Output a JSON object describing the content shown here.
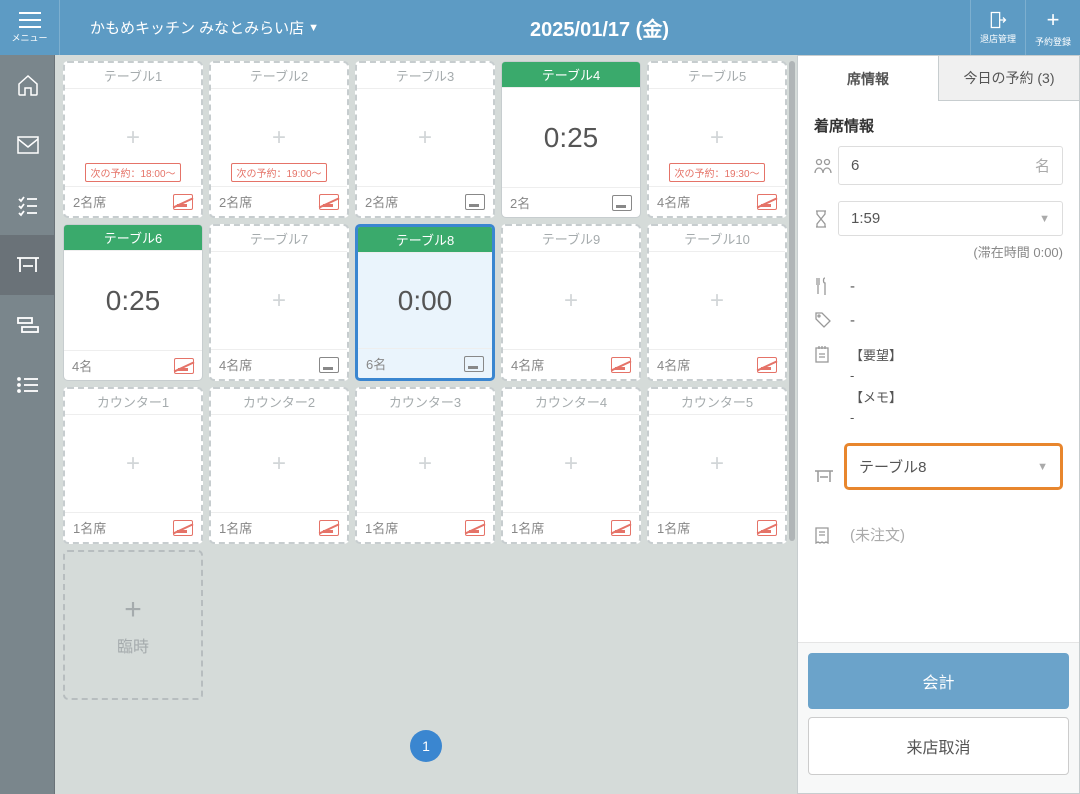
{
  "header": {
    "menu_label": "メニュー",
    "store_name": "かもめキッチン みなとみらい店",
    "date": "2025/01/17 (金)",
    "store_mgmt_label": "退店管理",
    "add_reservation_label": "予約登録"
  },
  "tables": [
    {
      "name": "テーブル1",
      "timer": "",
      "seats": "2名席",
      "next": "次の予約：18:00～",
      "occupied": false,
      "smoke": "no"
    },
    {
      "name": "テーブル2",
      "timer": "",
      "seats": "2名席",
      "next": "次の予約：19:00～",
      "occupied": false,
      "smoke": "no"
    },
    {
      "name": "テーブル3",
      "timer": "",
      "seats": "2名席",
      "next": "",
      "occupied": false,
      "smoke": "yes"
    },
    {
      "name": "テーブル4",
      "timer": "0:25",
      "seats": "2名",
      "next": "",
      "occupied": true,
      "smoke": "yes"
    },
    {
      "name": "テーブル5",
      "timer": "",
      "seats": "4名席",
      "next": "次の予約：19:30～",
      "occupied": false,
      "smoke": "no"
    },
    {
      "name": "テーブル6",
      "timer": "0:25",
      "seats": "4名",
      "next": "",
      "occupied": true,
      "smoke": "no"
    },
    {
      "name": "テーブル7",
      "timer": "",
      "seats": "4名席",
      "next": "",
      "occupied": false,
      "smoke": "yes"
    },
    {
      "name": "テーブル8",
      "timer": "0:00",
      "seats": "6名",
      "next": "",
      "occupied": true,
      "smoke": "yes",
      "selected": true
    },
    {
      "name": "テーブル9",
      "timer": "",
      "seats": "4名席",
      "next": "",
      "occupied": false,
      "smoke": "no"
    },
    {
      "name": "テーブル10",
      "timer": "",
      "seats": "4名席",
      "next": "",
      "occupied": false,
      "smoke": "no"
    },
    {
      "name": "カウンター1",
      "timer": "",
      "seats": "1名席",
      "next": "",
      "occupied": false,
      "smoke": "no"
    },
    {
      "name": "カウンター2",
      "timer": "",
      "seats": "1名席",
      "next": "",
      "occupied": false,
      "smoke": "no"
    },
    {
      "name": "カウンター3",
      "timer": "",
      "seats": "1名席",
      "next": "",
      "occupied": false,
      "smoke": "no"
    },
    {
      "name": "カウンター4",
      "timer": "",
      "seats": "1名席",
      "next": "",
      "occupied": false,
      "smoke": "no"
    },
    {
      "name": "カウンター5",
      "timer": "",
      "seats": "1名席",
      "next": "",
      "occupied": false,
      "smoke": "no"
    }
  ],
  "temp_label": "臨時",
  "page_number": "1",
  "panel": {
    "tab_seat_info": "席情報",
    "tab_today_resv": "今日の予約 (3)",
    "section_title": "着席情報",
    "guest_count": "6",
    "guest_unit": "名",
    "time_value": "1:59",
    "stay_time": "(滞在時間 0:00)",
    "course_value": "-",
    "tag_value": "-",
    "memo_request_label": "【要望】",
    "memo_request_value": "-",
    "memo_note_label": "【メモ】",
    "memo_note_value": "-",
    "table_select": "テーブル8",
    "order_status": "(未注文)",
    "btn_checkout": "会計",
    "btn_cancel": "来店取消"
  }
}
